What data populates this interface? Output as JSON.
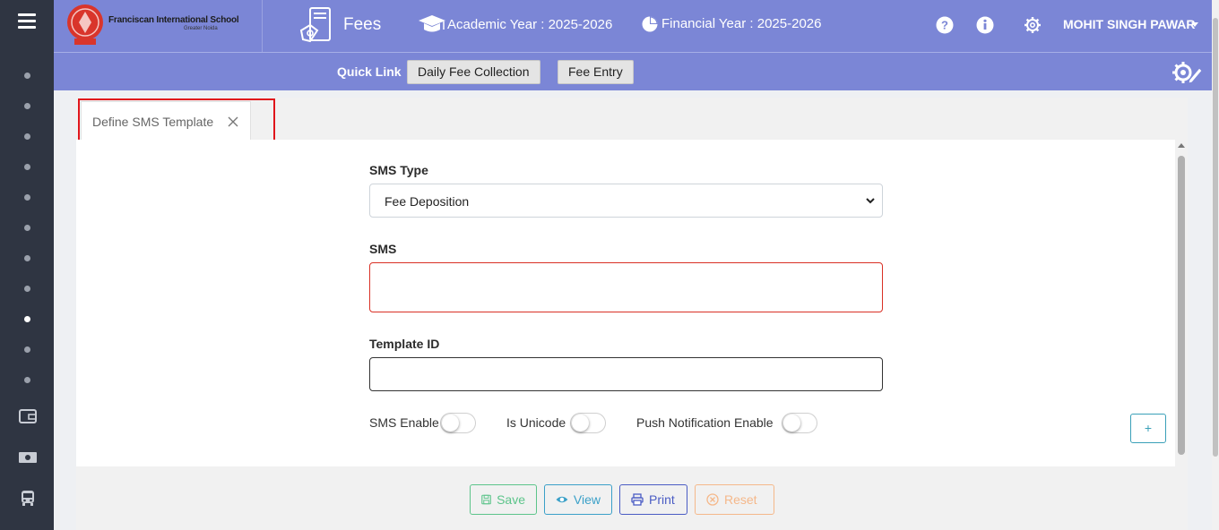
{
  "header": {
    "school_name": "Franciscan International School",
    "school_sub": "Greater Noida",
    "module_title": "Fees",
    "academic_year": "Academic Year : 2025-2026",
    "financial_year": "Financial Year : 2025-2026",
    "user_name": "MOHIT SINGH PAWAR"
  },
  "quick_links": {
    "label": "Quick Link",
    "buttons": [
      "Daily Fee Collection",
      "Fee Entry"
    ]
  },
  "tab": {
    "label": "Define SMS Template"
  },
  "form": {
    "sms_type_label": "SMS Type",
    "sms_type_value": "Fee Deposition",
    "sms_label": "SMS",
    "sms_value": "",
    "template_id_label": "Template ID",
    "template_id_value": "",
    "toggles": [
      {
        "label": "SMS Enable",
        "on": false
      },
      {
        "label": "Is Unicode",
        "on": false
      },
      {
        "label": "Push Notification Enable",
        "on": false
      }
    ],
    "add_symbol": "+"
  },
  "actions": {
    "save": "Save",
    "view": "View",
    "print": "Print",
    "reset": "Reset"
  },
  "colors": {
    "header_bg": "#7b86d6",
    "sidebar_bg": "#2f3542",
    "highlight": "#e0151b",
    "save": "#5cc48a",
    "view": "#3aa0c8",
    "print": "#4a5cc4",
    "reset": "#f5b88a"
  }
}
